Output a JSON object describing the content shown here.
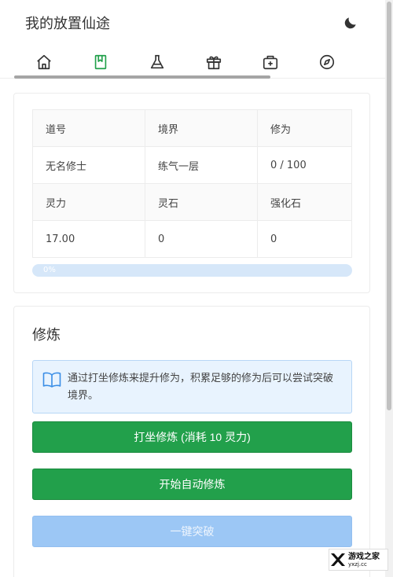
{
  "app": {
    "title": "我的放置仙途"
  },
  "header": {
    "theme_icon": "moon-icon"
  },
  "tabs": [
    {
      "icon": "home-icon",
      "active": false
    },
    {
      "icon": "book-icon",
      "active": true
    },
    {
      "icon": "flask-icon",
      "active": false
    },
    {
      "icon": "gift-icon",
      "active": false
    },
    {
      "icon": "medkit-icon",
      "active": false
    },
    {
      "icon": "compass-icon",
      "active": false
    }
  ],
  "stats": {
    "row1_labels": [
      "道号",
      "境界",
      "修为"
    ],
    "row1_values": [
      "无名修士",
      "练气一层",
      "0 / 100"
    ],
    "row2_labels": [
      "灵力",
      "灵石",
      "强化石"
    ],
    "row2_values": [
      "17.00",
      "0",
      "0"
    ]
  },
  "progress": {
    "label": "0%",
    "value": 0
  },
  "training": {
    "title": "修炼",
    "info": "通过打坐修炼来提升修为，积累足够的修为后可以尝试突破境界。",
    "meditate_button": "打坐修炼 (消耗 10 灵力)",
    "auto_button": "开始自动修炼",
    "breakthrough_button": "一键突破"
  },
  "watermark": {
    "title": "游戏之家",
    "subtitle": "yxzj.cc"
  },
  "colors": {
    "accent_green": "#22a04b",
    "accent_blue": "#3a8ee6",
    "disabled_blue": "#9cc7f5",
    "active_tab": "#22a04b"
  }
}
